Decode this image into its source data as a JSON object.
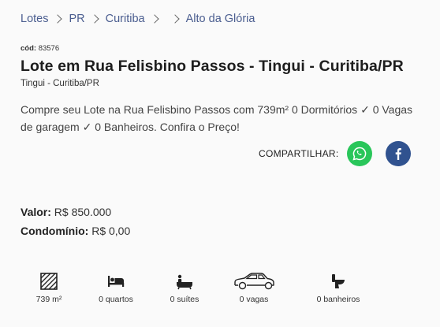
{
  "breadcrumb": {
    "items": [
      "Lotes",
      "PR",
      "Curitiba",
      "",
      "Alto da Glória"
    ]
  },
  "listing": {
    "code_label": "cód:",
    "code_value": "83576",
    "title": "Lote em Rua Felisbino Passos - Tingui - Curitiba/PR",
    "subtitle": "Tingui - Curitiba/PR",
    "description": "Compre seu Lote na Rua Felisbino Passos com 739m² 0 Dormitórios ✓ 0 Vagas de garagem ✓ 0 Banheiros. Confira o Preço!"
  },
  "share": {
    "label": "COMPARTILHAR:",
    "whatsapp_icon": "whatsapp-icon",
    "facebook_icon": "facebook-icon",
    "whatsapp_color": "#29c65a",
    "facebook_color": "#30528f"
  },
  "prices": {
    "valor_label": "Valor:",
    "valor": "R$ 850.000",
    "condominio_label": "Condomínio:",
    "condominio": "R$ 0,00"
  },
  "features": [
    {
      "icon": "area-icon",
      "label": "739 m²"
    },
    {
      "icon": "bed-icon",
      "label": "0 quartos"
    },
    {
      "icon": "bathtub-icon",
      "label": "0 suítes"
    },
    {
      "icon": "car-icon",
      "label": "0 vagas"
    },
    {
      "icon": "toilet-icon",
      "label": "0 banheiros"
    }
  ]
}
